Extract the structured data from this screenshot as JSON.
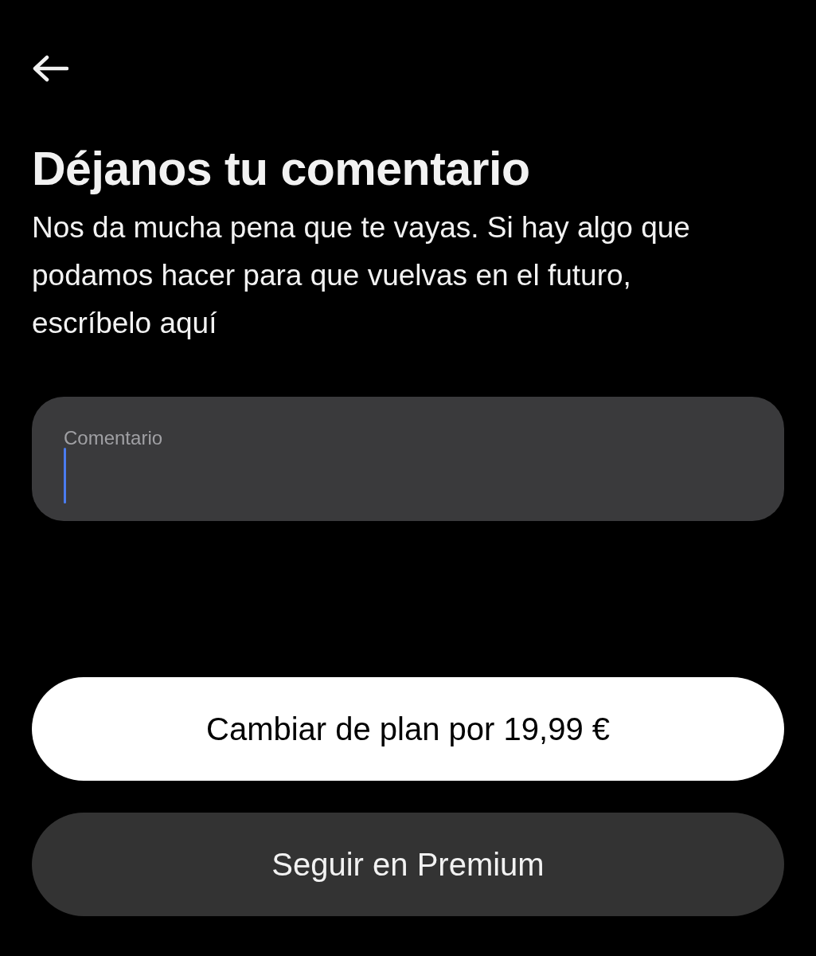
{
  "title": "Déjanos tu comentario",
  "description": "Nos da mucha pena que te vayas. Si hay algo que podamos hacer para que vuelvas en el futuro, escríbelo aquí",
  "comment_field": {
    "label": "Comentario",
    "focused": true
  },
  "buttons": [
    {
      "label": "Cambiar de plan por 19,99 €",
      "kind": "primary"
    },
    {
      "label": "Seguir en Premium",
      "kind": "secondary"
    }
  ]
}
